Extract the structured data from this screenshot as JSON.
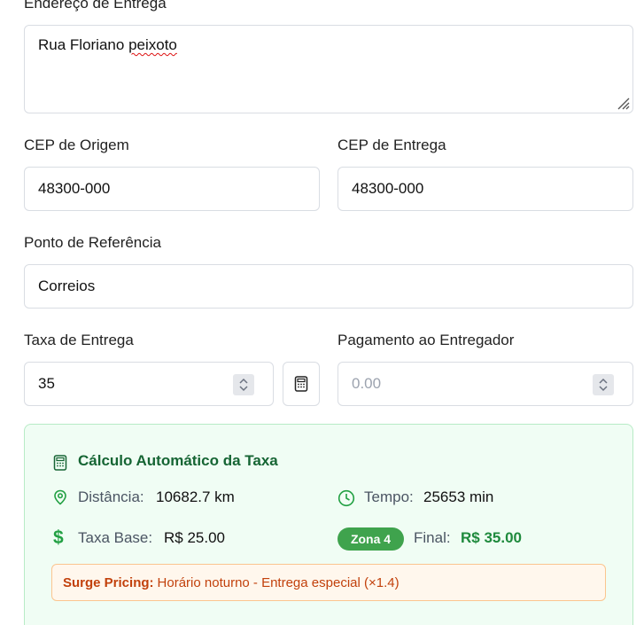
{
  "address": {
    "label": "Endereço de Entrega",
    "value_part1": "Rua Floriano ",
    "value_part2": "peixoto"
  },
  "cep_origin": {
    "label": "CEP de Origem",
    "value": "48300-000"
  },
  "cep_delivery": {
    "label": "CEP de Entrega",
    "value": "48300-000"
  },
  "reference": {
    "label": "Ponto de Referência",
    "value": "Correios"
  },
  "delivery_fee": {
    "label": "Taxa de Entrega",
    "value": "35"
  },
  "courier_payment": {
    "label": "Pagamento ao Entregador",
    "placeholder": "0.00"
  },
  "auto_calc": {
    "title": "Cálculo Automático da Taxa",
    "distance_label": "Distância:",
    "distance_value": "10682.7 km",
    "time_label": "Tempo:",
    "time_value": "25653 min",
    "base_label": "Taxa Base:",
    "base_value": "R$ 25.00",
    "zone_badge": "Zona 4",
    "final_label": "Final:",
    "final_value": "R$ 35.00",
    "surge_title": "Surge Pricing:",
    "surge_text": "Horário noturno - Entrega especial (×1.4)"
  },
  "colors": {
    "accent_green": "#1f8a3d",
    "panel_bg": "#f0fdf4",
    "surge_orange": "#c2410c"
  },
  "icons": [
    "resize-grip-icon",
    "spinner-icon",
    "calculator-icon",
    "map-pin-icon",
    "clock-icon",
    "dollar-icon"
  ]
}
